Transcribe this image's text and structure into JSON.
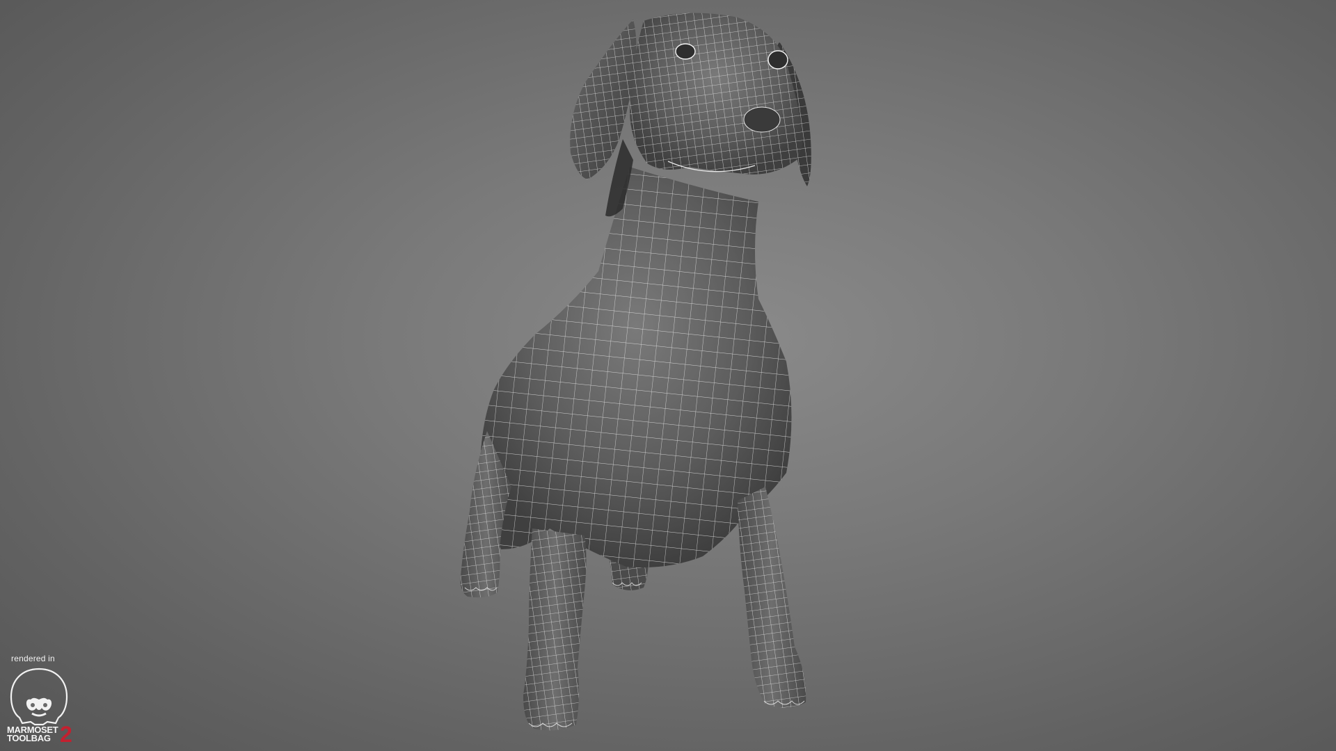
{
  "scene": {
    "model": "dachshund-wireframe-render",
    "background_color": "#777777",
    "wire_color": "#ffffff"
  },
  "badge": {
    "caption": "rendered in",
    "brand_line1": "MARMOSET",
    "brand_line2": "TOOLBAG",
    "version": "2",
    "logo_icon": "monkey-skull-icon",
    "brand_color": "#c4202f"
  }
}
